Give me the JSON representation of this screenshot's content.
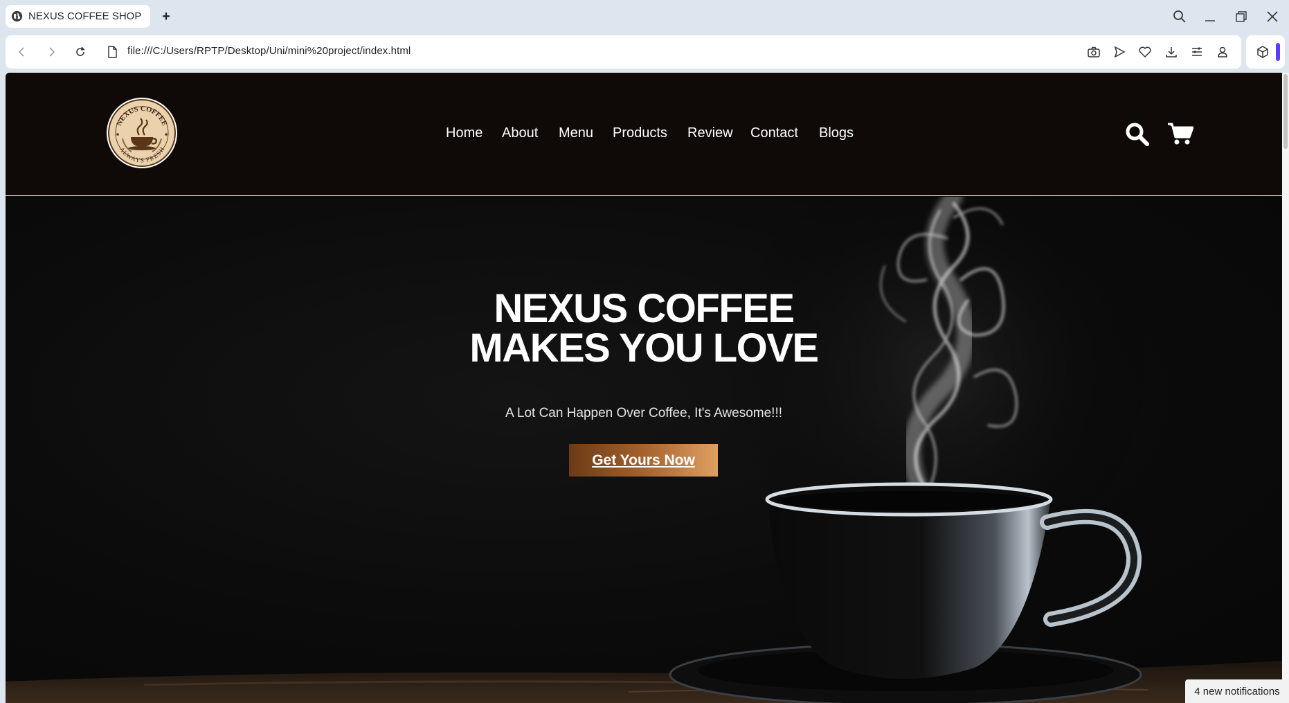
{
  "browser": {
    "tab_title": "NEXUS COFFEE SHOP",
    "new_tab_label": "+",
    "url": "file:///C:/Users/RPTP/Desktop/Uni/mini%20project/index.html",
    "toolbar_icons": [
      "camera-icon",
      "send-icon",
      "heart-icon",
      "download-icon",
      "menu-icon",
      "profile-icon",
      "extension-icon"
    ],
    "window_controls": [
      "search-icon",
      "minimize-icon",
      "restore-icon",
      "close-icon"
    ],
    "accent_color": "#5b3df5"
  },
  "site": {
    "logo": {
      "top_text": "NEXUS COFFEE",
      "bottom_text": "ALWAYS FRESH"
    },
    "nav": [
      "Home",
      "About",
      "Menu",
      "Products",
      "Review",
      "Contact",
      "Blogs"
    ],
    "header_icons": [
      "search-icon",
      "cart-icon"
    ],
    "hero": {
      "title_line1": "NEXUS COFFEE",
      "title_line2": "MAKES YOU LOVE",
      "subtitle": "A Lot Can Happen Over Coffee, It's Awesome!!!",
      "cta_label": "Get Yours Now"
    }
  },
  "notification": "4 new notifications",
  "colors": {
    "header_bg": "#0f0a07",
    "cta_gradient_start": "#6b3a17",
    "cta_gradient_end": "#e0a062"
  }
}
